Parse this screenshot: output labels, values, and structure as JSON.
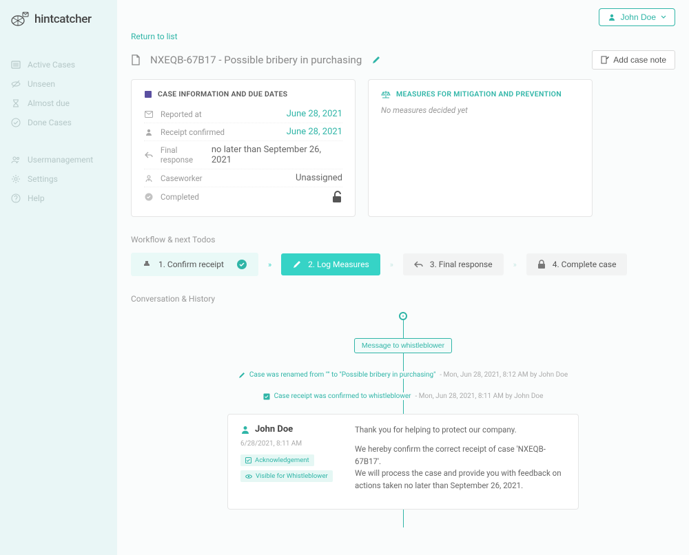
{
  "brand": {
    "name": "hintcatcher"
  },
  "user": {
    "name": "John Doe"
  },
  "sidebar": {
    "items": [
      {
        "label": "Active Cases",
        "icon": "list-icon"
      },
      {
        "label": "Unseen",
        "icon": "eye-off-icon"
      },
      {
        "label": "Almost due",
        "icon": "hourglass-icon"
      },
      {
        "label": "Done Cases",
        "icon": "check-circle-icon"
      }
    ],
    "items2": [
      {
        "label": "Usermanagement",
        "icon": "users-icon"
      },
      {
        "label": "Settings",
        "icon": "gear-icon"
      },
      {
        "label": "Help",
        "icon": "help-icon"
      }
    ]
  },
  "header": {
    "return": "Return to list",
    "case_id": "NXEQB-67B17 - Possible bribery in purchasing",
    "add_note": "Add case note"
  },
  "info": {
    "title": "CASE INFORMATION AND DUE DATES",
    "rows": [
      {
        "label": "Reported at",
        "value": "June 28, 2021",
        "teal": true,
        "icon": "mail-icon"
      },
      {
        "label": "Receipt confirmed",
        "value": "June 28, 2021",
        "teal": true,
        "icon": "user-icon"
      },
      {
        "label": "Final response",
        "value": "no later than September 26, 2021",
        "teal": false,
        "icon": "reply-icon"
      },
      {
        "label": "Caseworker",
        "value": "Unassigned",
        "teal": false,
        "icon": "worker-icon"
      },
      {
        "label": "Completed",
        "value": "",
        "teal": false,
        "icon": "check-icon",
        "lock": true
      }
    ]
  },
  "measures": {
    "title": "MEASURES FOR MITIGATION AND PREVENTION",
    "empty": "No measures decided yet"
  },
  "workflow": {
    "title": "Workflow & next Todos",
    "steps": [
      {
        "label": "1. Confirm receipt",
        "state": "done",
        "icon": "stamp-icon"
      },
      {
        "label": "2. Log Measures",
        "state": "active",
        "icon": "pen-icon"
      },
      {
        "label": "3. Final response",
        "state": "pending",
        "icon": "reply-icon"
      },
      {
        "label": "4. Complete case",
        "state": "pending",
        "icon": "lock-icon"
      }
    ]
  },
  "history": {
    "title": "Conversation & History",
    "pill": "Message to whistleblower",
    "events": [
      {
        "text": "Case was renamed from \"\" to \"Possible bribery in purchasing\"",
        "time": "Mon, Jun 28, 2021, 8:12 AM by John Doe",
        "icon": "pen-icon"
      },
      {
        "text": "Case receipt was confirmed to whistleblower",
        "time": "Mon, Jun 28, 2021, 8:11 AM by John Doe",
        "icon": "check-square-icon"
      }
    ],
    "message": {
      "author": "John Doe",
      "time": "6/28/2021, 8:11 AM",
      "tags": [
        {
          "label": "Acknowledgement",
          "icon": "check-square-icon"
        },
        {
          "label": "Visible for Whistleblower",
          "icon": "eye-icon"
        }
      ],
      "para1": "Thank you for helping to protect our company.",
      "para2": "We hereby confirm the correct receipt of case 'NXEQB-67B17'.",
      "para3": "We will process the case and provide you with feedback on actions taken no later than September 26, 2021."
    }
  }
}
